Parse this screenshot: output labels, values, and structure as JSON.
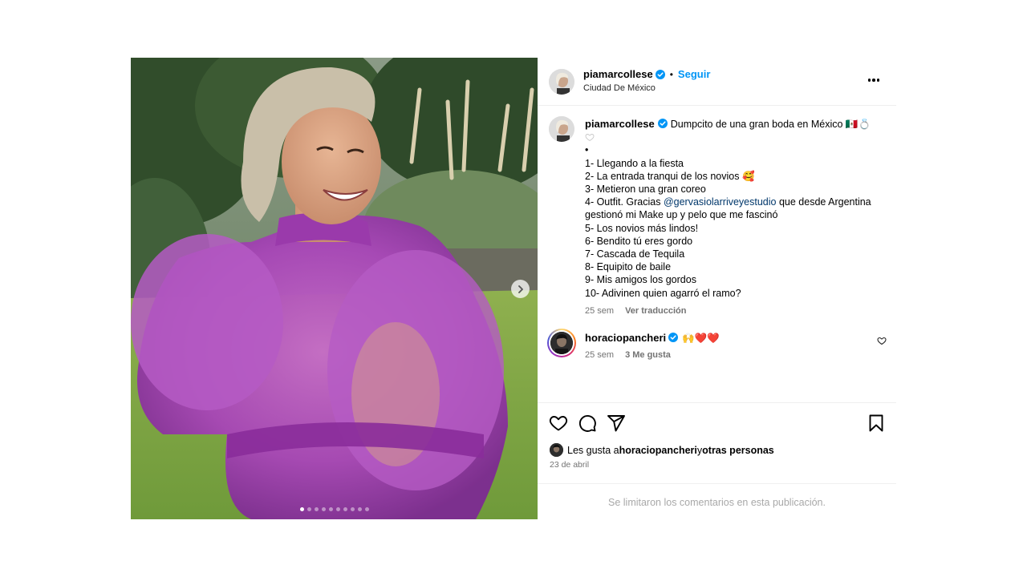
{
  "colors": {
    "accent": "#0095f6",
    "verified": "#0095f6",
    "like_red": "#ff3040",
    "muted": "#737373",
    "dress": "#a845b8"
  },
  "header": {
    "username": "piamarcollese",
    "separator": "•",
    "follow_label": "Seguir",
    "location": "Ciudad De México",
    "more_icon": "more-options-icon"
  },
  "media": {
    "description_icon": "photo",
    "carousel_index": 1,
    "carousel_total": 10,
    "next_icon": "chevron-right-icon"
  },
  "caption": {
    "username": "piamarcollese",
    "line_title": "Dumpcito de una gran boda en México 🇲🇽💍",
    "bullet": "•",
    "lines": [
      "1- Llegando a la fiesta",
      "2- La entrada tranqui de los novios 🥰",
      "3- Metieron una gran coreo"
    ],
    "outfit_prefix": "4- Outfit. Gracias ",
    "outfit_mention": "@gervasiolarriveyestudio",
    "outfit_suffix": " que desde Argentina",
    "outfit_line2": "gestionó mi Make up y pelo que me fascinó",
    "lines_after": [
      "5- Los novios más lindos!",
      "6- Bendito tú eres gordo",
      "7- Cascada de Tequila",
      "8- Equipito de baile",
      "9- Mis amigos los gordos",
      "10- Adivinen quien agarró el ramo?"
    ],
    "time": "25 sem",
    "translate": "Ver traducción"
  },
  "comment": {
    "username": "horaciopancheri",
    "text": "🙌❤️❤️",
    "time": "25 sem",
    "likes": "3 Me gusta"
  },
  "actions": {
    "like_icon": "heart-icon",
    "comment_icon": "comment-icon",
    "share_icon": "share-icon",
    "save_icon": "bookmark-icon",
    "likes_prefix": "Les gusta a ",
    "likes_user": "horaciopancheri",
    "likes_join": " y ",
    "likes_others": "otras personas",
    "date": "23 de abril",
    "comments_limited": "Se limitaron los comentarios en esta publicación."
  }
}
